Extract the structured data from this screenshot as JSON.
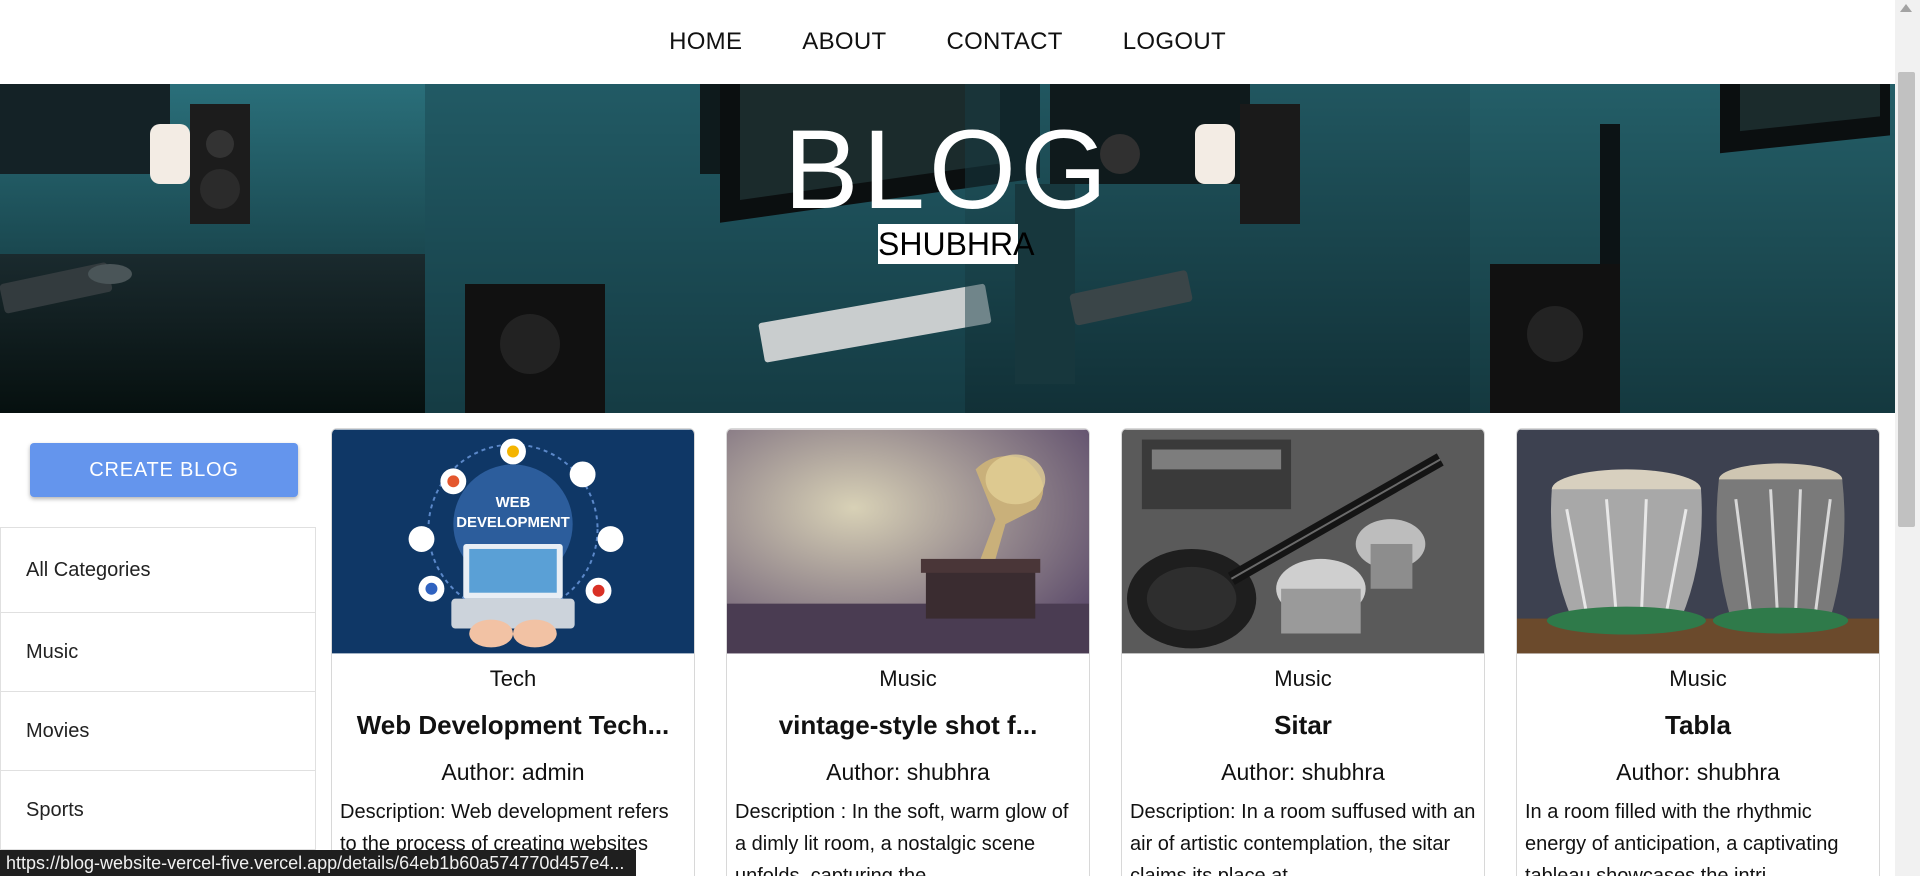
{
  "nav": {
    "items": [
      "HOME",
      "ABOUT",
      "CONTACT",
      "LOGOUT"
    ]
  },
  "hero": {
    "title": "BLOG",
    "subtitle": "SHUBHRA"
  },
  "sidebar": {
    "create_label": "CREATE BLOG",
    "categories": [
      "All Categories",
      "Music",
      "Movies",
      "Sports"
    ]
  },
  "cards": [
    {
      "category": "Tech",
      "title": "Web Development Tech...",
      "author": "Author: admin",
      "description": "Description: Web development refers to the process of creating websites and web applications for",
      "thumb_text_1": "WEB",
      "thumb_text_2": "DEVELOPMENT"
    },
    {
      "category": "Music",
      "title": "vintage-style shot f...",
      "author": "Author: shubhra",
      "description": "Description : In the soft, warm glow of a dimly lit room, a nostalgic scene unfolds, capturing the"
    },
    {
      "category": "Music",
      "title": "Sitar",
      "author": "Author: shubhra",
      "description": "Description: In a room suffused with an air of artistic contemplation, the sitar claims its place at"
    },
    {
      "category": "Music",
      "title": "Tabla",
      "author": "Author: shubhra",
      "description": "In a room filled with the rhythmic energy of anticipation, a captivating tableau showcases the intri"
    }
  ],
  "status_bar": {
    "url": "https://blog-website-vercel-five.vercel.app/details/64eb1b60a574770d457e4..."
  },
  "colors": {
    "create_button": "#6495ed",
    "hero_tint": "#14363d"
  }
}
